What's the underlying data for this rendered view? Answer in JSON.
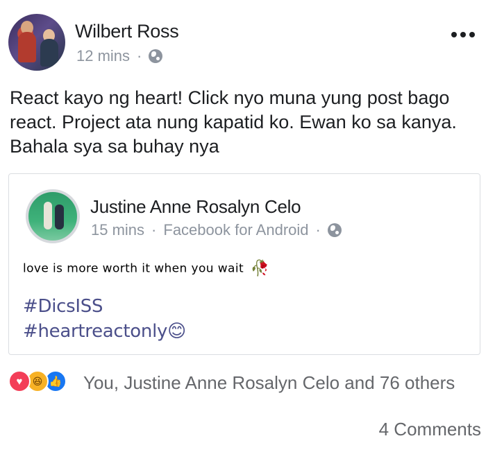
{
  "post": {
    "author": "Wilbert Ross",
    "time": "12 mins",
    "separator": "·",
    "privacy_icon": "globe-icon",
    "more_icon": "more-horizontal-icon",
    "text": "React kayo ng heart! Click nyo muna yung post bago react. Project ata nung kapatid ko. Ewan ko sa kanya. Bahala sya sa buhay nya"
  },
  "shared_post": {
    "author": "Justine Anne Rosalyn Celo",
    "time": "15 mins",
    "separator": "·",
    "source": "Facebook for Android",
    "privacy_icon": "globe-icon",
    "text": "love is more worth it when you wait",
    "rose_emoji": "🥀",
    "hashtag1": "#DicsISS",
    "hashtag2": "#heartreactonly",
    "smile_emoji": "😊"
  },
  "reactions": {
    "icons": [
      "love-icon",
      "haha-icon",
      "like-icon"
    ],
    "love_symbol": "♥",
    "haha_symbol": "😆",
    "like_symbol": "👍",
    "summary": "You, Justine Anne Rosalyn Celo and 76 others",
    "comments": "4 Comments"
  },
  "colors": {
    "secondary_text": "#8d949e",
    "hashtag": "#4b4f8a",
    "love": "#f33e58",
    "haha": "#f7b125",
    "like": "#1877f2"
  }
}
